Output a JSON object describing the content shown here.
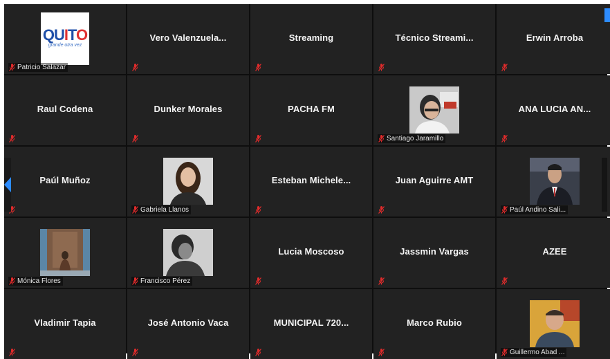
{
  "accent_color": "#2d8cff",
  "muted_icon_color": "#e02b2b",
  "logo": {
    "text": "QUITO",
    "subtitle": "grande otra vez"
  },
  "tiles": [
    {
      "name": "",
      "label": "Patricio Salazar",
      "kind": "logo"
    },
    {
      "name": "Vero  Valenzuela...",
      "label": "",
      "kind": "text"
    },
    {
      "name": "Streaming",
      "label": "",
      "kind": "text"
    },
    {
      "name": "Técnico  Streami...",
      "label": "",
      "kind": "text"
    },
    {
      "name": "Erwin Arroba",
      "label": "",
      "kind": "text"
    },
    {
      "name": "Raul Codena",
      "label": "",
      "kind": "text"
    },
    {
      "name": "Dunker Morales",
      "label": "",
      "kind": "text"
    },
    {
      "name": "PACHA FM",
      "label": "",
      "kind": "text"
    },
    {
      "name": "",
      "label": "Santiago Jaramillo",
      "kind": "photo"
    },
    {
      "name": "ANA LUCIA AN...",
      "label": "",
      "kind": "text"
    },
    {
      "name": "Paúl Muñoz",
      "label": "",
      "kind": "text"
    },
    {
      "name": "",
      "label": "Gabriela Llanos",
      "kind": "photo"
    },
    {
      "name": "Esteban  Michele...",
      "label": "",
      "kind": "text"
    },
    {
      "name": "Juan Aguirre AMT",
      "label": "",
      "kind": "text"
    },
    {
      "name": "",
      "label": "Paúl Andino Sali...",
      "kind": "photo"
    },
    {
      "name": "",
      "label": "Mónica Flores",
      "kind": "photo"
    },
    {
      "name": "",
      "label": "Francisco Pérez",
      "kind": "photo"
    },
    {
      "name": "Lucia Moscoso",
      "label": "",
      "kind": "text"
    },
    {
      "name": "Jassmin Vargas",
      "label": "",
      "kind": "text"
    },
    {
      "name": "AZEE",
      "label": "",
      "kind": "text"
    },
    {
      "name": "Vladimir Tapia",
      "label": "",
      "kind": "text"
    },
    {
      "name": "José Antonio Vaca",
      "label": "",
      "kind": "text"
    },
    {
      "name": "MUNICIPAL  720...",
      "label": "",
      "kind": "text"
    },
    {
      "name": "Marco Rubio",
      "label": "",
      "kind": "text"
    },
    {
      "name": "",
      "label": "Guillermo Abad ...",
      "kind": "photo"
    }
  ]
}
